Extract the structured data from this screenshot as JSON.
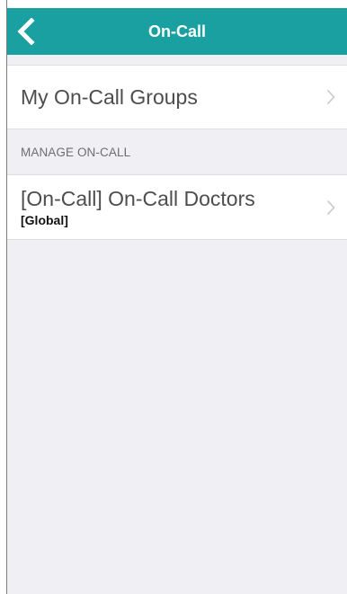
{
  "nav": {
    "title": "On-Call",
    "back_icon": "chevron-left-icon",
    "bar_color": "#1aa0a0"
  },
  "my_groups": {
    "label": "My On-Call Groups",
    "chevron_icon": "chevron-right-icon"
  },
  "manage_section": {
    "header": "MANAGE ON-CALL",
    "items": [
      {
        "label": "[On-Call] On-Call Doctors",
        "sublabel": "[Global]",
        "chevron_icon": "chevron-right-icon"
      }
    ]
  }
}
